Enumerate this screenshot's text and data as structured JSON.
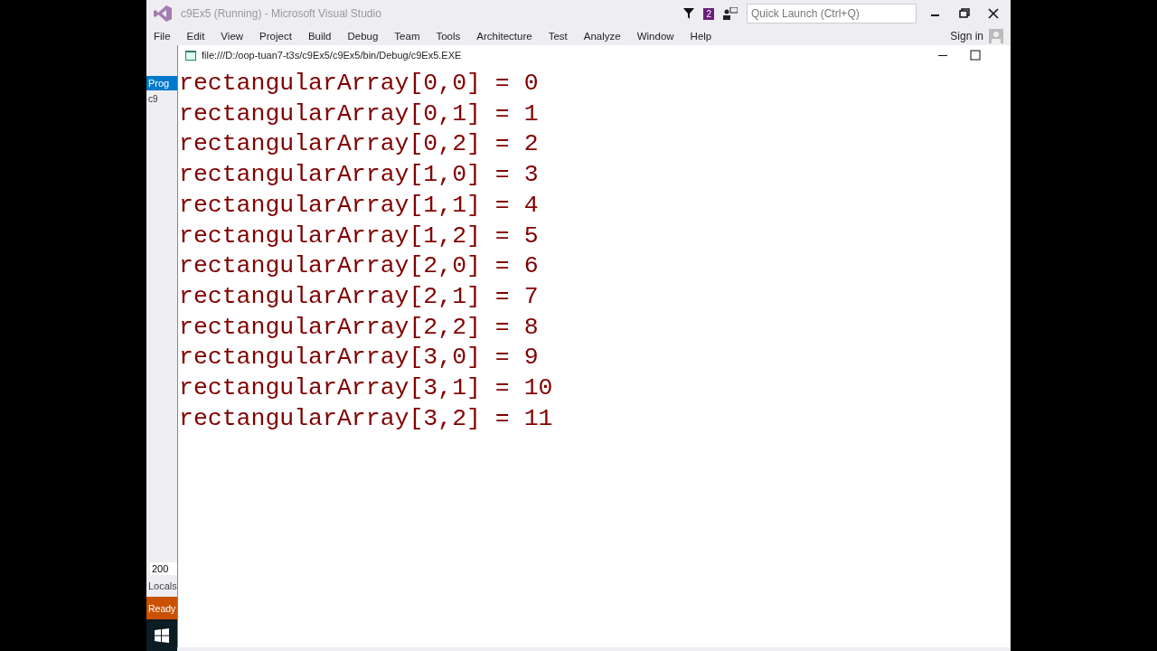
{
  "window": {
    "title": "c9Ex5 (Running) - Microsoft Visual Studio",
    "notification_count": "2",
    "quick_launch": {
      "placeholder": "Quick Launch (Ctrl+Q)"
    }
  },
  "menu": [
    "File",
    "Edit",
    "View",
    "Project",
    "Build",
    "Debug",
    "Team",
    "Tools",
    "Architecture",
    "Test",
    "Analyze",
    "Window",
    "Help"
  ],
  "sign_in": "Sign in",
  "side": {
    "tab": "Prog",
    "item": "c9",
    "zoom": "200",
    "panel": "Locals"
  },
  "status": "Ready",
  "console": {
    "title": "file:///D:/oop-tuan7-t3s/c9Ex5/c9Ex5/bin/Debug/c9Ex5.EXE",
    "lines": [
      "rectangularArray[0,0] = 0",
      "rectangularArray[0,1] = 1",
      "rectangularArray[0,2] = 2",
      "rectangularArray[1,0] = 3",
      "rectangularArray[1,1] = 4",
      "rectangularArray[1,2] = 5",
      "rectangularArray[2,0] = 6",
      "rectangularArray[2,1] = 7",
      "rectangularArray[2,2] = 8",
      "rectangularArray[3,0] = 9",
      "rectangularArray[3,1] = 10",
      "rectangularArray[3,2] = 11"
    ]
  }
}
